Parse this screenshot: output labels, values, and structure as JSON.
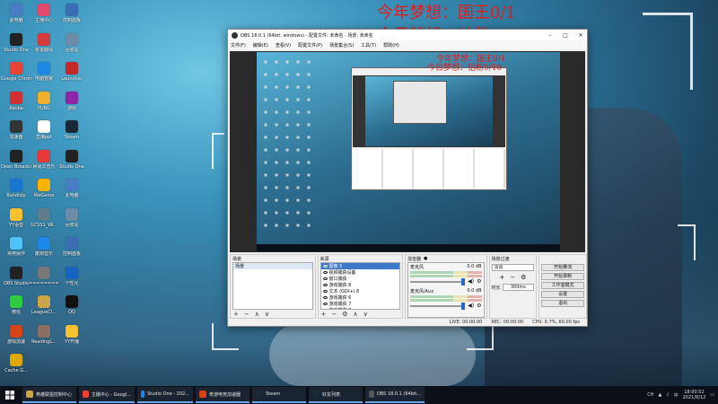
{
  "overlay": {
    "line1": "今年梦想：国王0/1",
    "line2": "今日梦想：钻粉9/10"
  },
  "desktop_icons": [
    {
      "label": "此电脑",
      "color": "#4a7cc4",
      "glyph": "computer-icon"
    },
    {
      "label": "主播中心",
      "color": "#e14a6b",
      "glyph": "app-icon"
    },
    {
      "label": "控制面板",
      "color": "#3b6db3",
      "glyph": "control-panel-icon"
    },
    {
      "label": "Studio One",
      "color": "#222",
      "glyph": "studio-one-icon"
    },
    {
      "label": "有道翻译",
      "color": "#d63b3b",
      "glyph": "translate-icon"
    },
    {
      "label": "回收站",
      "color": "#6c8ca8",
      "glyph": "recycle-bin-icon"
    },
    {
      "label": "Google Chrome",
      "color": "#ea4335",
      "glyph": "chrome-icon"
    },
    {
      "label": "电脑管家",
      "color": "#1e88e5",
      "glyph": "shield-icon"
    },
    {
      "label": "Launcher",
      "color": "#c62828",
      "glyph": "launcher-icon"
    },
    {
      "label": "Adobe",
      "color": "#d32f2f",
      "glyph": "adobe-icon"
    },
    {
      "label": "PUBG",
      "color": "#f0b02c",
      "glyph": "game-icon"
    },
    {
      "label": "游戏",
      "color": "#8e24aa",
      "glyph": "game-icon"
    },
    {
      "label": "加速器",
      "color": "#333",
      "glyph": "booster-icon"
    },
    {
      "label": "直播ppt",
      "color": "#fff",
      "glyph": "doc-icon"
    },
    {
      "label": "Steam",
      "color": "#1b2838",
      "glyph": "steam-icon"
    },
    {
      "label": "Open Broadcast",
      "color": "#222",
      "glyph": "obs-icon"
    },
    {
      "label": "网易云音乐",
      "color": "#e53935",
      "glyph": "music-icon"
    },
    {
      "label": "Studio One",
      "color": "#222",
      "glyph": "studio-one-icon"
    },
    {
      "label": "Bandizip",
      "color": "#1976d2",
      "glyph": "zip-icon"
    },
    {
      "label": "WeGame",
      "color": "#ffb300",
      "glyph": "wegame-icon"
    },
    {
      "label": "此电脑",
      "color": "#4a7cc4",
      "glyph": "computer-icon"
    },
    {
      "label": "YY语音",
      "color": "#fbc02d",
      "glyph": "yy-icon"
    },
    {
      "label": "GCSS1_Wi...",
      "color": "#607d8b",
      "glyph": "file-icon"
    },
    {
      "label": "回收站",
      "color": "#6c8ca8",
      "glyph": "recycle-bin-icon"
    },
    {
      "label": "常用操作",
      "color": "#4fc3f7",
      "glyph": "folder-icon"
    },
    {
      "label": "酷狗音乐",
      "color": "#1e88e5",
      "glyph": "kugou-icon"
    },
    {
      "label": "控制面板",
      "color": "#3b6db3",
      "glyph": "control-panel-icon"
    },
    {
      "label": "OBS Studio",
      "color": "#222",
      "glyph": "obs-icon"
    },
    {
      "label": "==========",
      "color": "#777",
      "glyph": "file-icon"
    },
    {
      "label": "个性化",
      "color": "#1565c0",
      "glyph": "settings-icon"
    },
    {
      "label": "微信",
      "color": "#2ecc40",
      "glyph": "wechat-icon"
    },
    {
      "label": "LeagueCl...",
      "color": "#c9a64a",
      "glyph": "league-icon"
    },
    {
      "label": "QQ",
      "color": "#111",
      "glyph": "qq-icon"
    },
    {
      "label": "游戏加速",
      "color": "#d84315",
      "glyph": "booster-icon"
    },
    {
      "label": "ReadingL...",
      "color": "#8d6e63",
      "glyph": "file-icon"
    },
    {
      "label": "YY开播",
      "color": "#fbc02d",
      "glyph": "yy-icon"
    },
    {
      "label": "Cache G...",
      "color": "#e0a800",
      "glyph": "file-icon"
    }
  ],
  "obs": {
    "title": "OBS 18.0.1 (64bit, windows) - 配置文件: 未命名 - 场景: 未命名",
    "menu": [
      "文件(F)",
      "编辑(E)",
      "查看(V)",
      "配置文件(P)",
      "场景集合(S)",
      "工具(T)",
      "帮助(H)"
    ],
    "docks": {
      "scenes": {
        "title": "场景",
        "items": [
          "场景"
        ]
      },
      "sources": {
        "title": "来源",
        "items": [
          "图像 5",
          "视频捕获设备",
          "窗口捕获",
          "游戏捕获 8",
          "文本 (GDI+) 8",
          "游戏捕获 6",
          "游戏捕获 7",
          "游戏捕获 8"
        ]
      },
      "mixer": {
        "title": "混音器",
        "channels": [
          {
            "name": "麦克风",
            "db": "0.0 dB"
          },
          {
            "name": "麦克风/Aux",
            "db": "0.0 dB"
          }
        ]
      },
      "transitions": {
        "title": "场景过渡",
        "select": "淡出",
        "duration_label": "时长",
        "duration": "300ms"
      },
      "controls": [
        "开始推流",
        "开始录制",
        "工作室模式",
        "设置",
        "退出"
      ]
    },
    "status": {
      "live": "LIVE: 00:00:00",
      "rec": "REC: 00:00:00",
      "cpu": "CPU: 0.7%, 60.00 fps"
    }
  },
  "taskbar": {
    "items": [
      {
        "label": "英雄联盟控制中心",
        "color": "#c9a64a"
      },
      {
        "label": "主播中心 - Googl...",
        "color": "#ea4335"
      },
      {
        "label": "Studio One - 202...",
        "color": "#1e88e5"
      },
      {
        "label": "奇游电竞加速器",
        "color": "#d84315"
      },
      {
        "label": "Steam",
        "color": "#1b2838"
      },
      {
        "label": "好友列表",
        "color": "#1b2838"
      },
      {
        "label": "OBS 18.0.1 (64bit...",
        "color": "#555"
      }
    ],
    "tray_lang": "CH",
    "tray_icons": [
      "network-icon",
      "volume-icon",
      "ime-icon"
    ],
    "ime": "中",
    "time": "18:00:52",
    "date": "2021/8/12"
  }
}
